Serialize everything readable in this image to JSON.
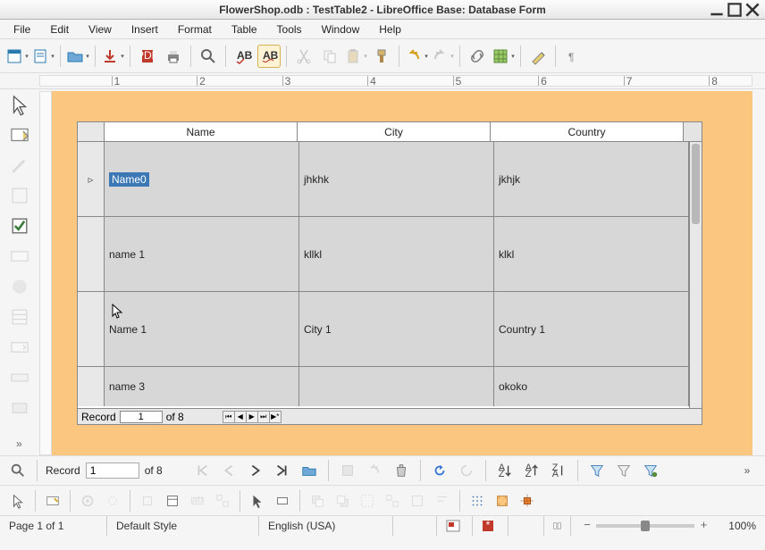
{
  "title": "FlowerShop.odb : TestTable2 - LibreOffice Base: Database Form",
  "menu": [
    "File",
    "Edit",
    "View",
    "Insert",
    "Format",
    "Table",
    "Tools",
    "Window",
    "Help"
  ],
  "ruler": [
    "1",
    "2",
    "3",
    "4",
    "5",
    "6",
    "7",
    "8"
  ],
  "table": {
    "columns": [
      "Name",
      "City",
      "Country"
    ],
    "rows": [
      {
        "marker": "▹",
        "cells": [
          "Name0",
          "jhkhk",
          "jkhjk"
        ],
        "selected_cell": 0
      },
      {
        "marker": "",
        "cells": [
          "name 1",
          "kllkl",
          "klkl"
        ]
      },
      {
        "marker": "",
        "cells": [
          "Name 1",
          "City 1",
          "Country 1"
        ]
      },
      {
        "marker": "",
        "cells": [
          "name 3",
          "",
          "okoko"
        ],
        "partial": true
      }
    ],
    "record_label": "Record",
    "record_current": "1",
    "record_of": "of 8"
  },
  "nav": {
    "find_icon": "find",
    "record_label": "Record",
    "record_value": "1",
    "record_of": "of  8"
  },
  "status": {
    "page": "Page 1 of 1",
    "style": "Default Style",
    "lang": "English (USA)",
    "zoom": "100%"
  }
}
